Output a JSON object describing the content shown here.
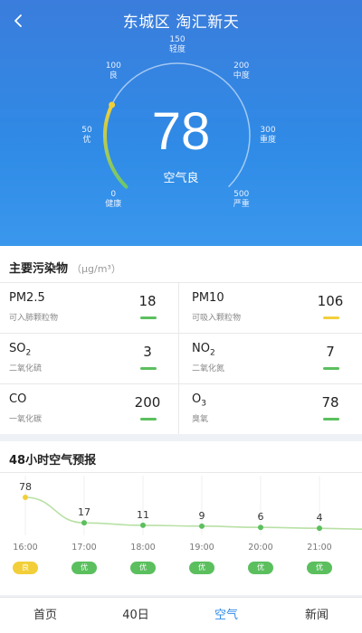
{
  "header": {
    "title": "东城区 淘汇新天",
    "back_icon": "chevron-left-icon"
  },
  "gauge": {
    "aqi": "78",
    "level_text": "空气良",
    "ticks": [
      {
        "value": "0",
        "label": "健康"
      },
      {
        "value": "50",
        "label": "优"
      },
      {
        "value": "100",
        "label": "良"
      },
      {
        "value": "150",
        "label": "轻度"
      },
      {
        "value": "200",
        "label": "中度"
      },
      {
        "value": "300",
        "label": "重度"
      },
      {
        "value": "500",
        "label": "严重"
      }
    ],
    "colors": {
      "green": "#6cc66b",
      "yellow": "#f2cf3a"
    }
  },
  "pollutants": {
    "title": "主要污染物",
    "unit": "（μg/m³）",
    "items": [
      {
        "name": "PM2.5",
        "sub": "",
        "desc": "可入肺颗粒物",
        "value": "18",
        "color": "#5bbf5e"
      },
      {
        "name": "PM10",
        "sub": "",
        "desc": "可吸入颗粒物",
        "value": "106",
        "color": "#f2cf3a"
      },
      {
        "name": "SO",
        "sub": "2",
        "desc": "二氧化硫",
        "value": "3",
        "color": "#5bbf5e"
      },
      {
        "name": "NO",
        "sub": "2",
        "desc": "二氧化氮",
        "value": "7",
        "color": "#5bbf5e"
      },
      {
        "name": "CO",
        "sub": "",
        "desc": "一氧化碳",
        "value": "200",
        "color": "#5bbf5e"
      },
      {
        "name": "O",
        "sub": "3",
        "desc": "臭氧",
        "value": "78",
        "color": "#5bbf5e"
      }
    ]
  },
  "forecast": {
    "title": "48小时空气预报",
    "points": [
      {
        "time": "16:00",
        "value": 78,
        "badge": "良",
        "badge_color": "#f2cf3a"
      },
      {
        "time": "17:00",
        "value": 17,
        "badge": "优",
        "badge_color": "#5bbf5e"
      },
      {
        "time": "18:00",
        "value": 11,
        "badge": "优",
        "badge_color": "#5bbf5e"
      },
      {
        "time": "19:00",
        "value": 9,
        "badge": "优",
        "badge_color": "#5bbf5e"
      },
      {
        "time": "20:00",
        "value": 6,
        "badge": "优",
        "badge_color": "#5bbf5e"
      },
      {
        "time": "21:00",
        "value": 4,
        "badge": "优",
        "badge_color": "#5bbf5e"
      }
    ]
  },
  "nav": {
    "items": [
      "首页",
      "40日",
      "空气",
      "新闻"
    ],
    "active": 2,
    "active_color": "#2f8be6"
  }
}
